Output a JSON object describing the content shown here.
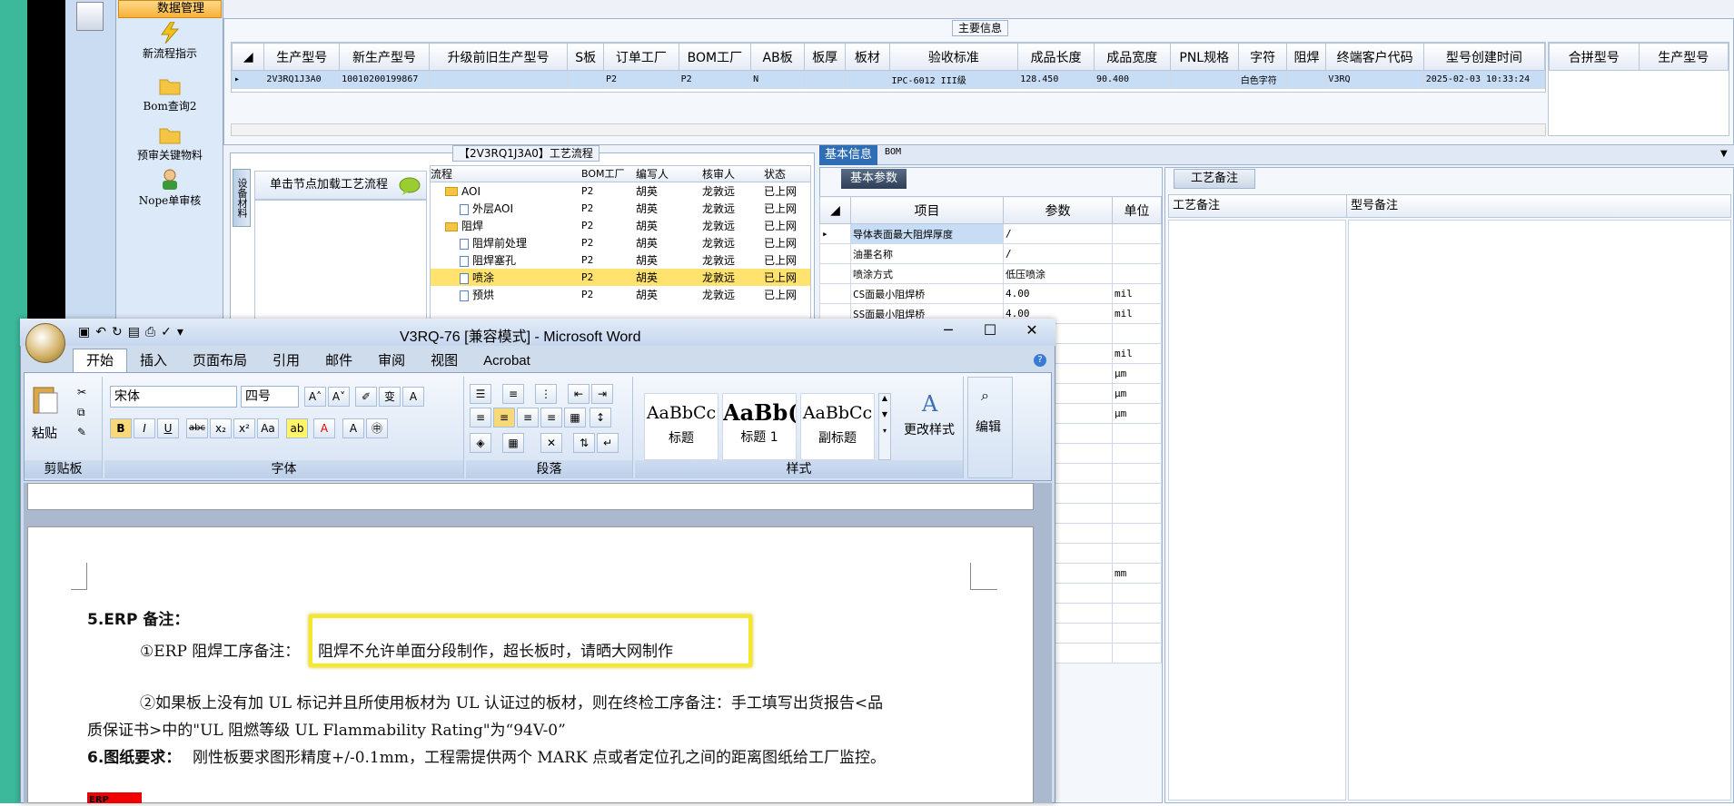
{
  "nav": {
    "data_mgmt": "数据管理",
    "items": [
      "新流程指示",
      "Bom查询2",
      "预审关键物料",
      "Nope单审核"
    ]
  },
  "main": {
    "section_title": "主要信息",
    "columns": [
      "生产型号",
      "新生产型号",
      "升级前旧生产型号",
      "S板",
      "订单工厂",
      "BOM工厂",
      "AB板",
      "板厚",
      "板材",
      "验收标准",
      "成品长度",
      "成品宽度",
      "PNL规格",
      "字符",
      "阻焊",
      "终端客户代码",
      "型号创建时间"
    ],
    "row": [
      "2V3RQ1J3A0",
      "10010200199867",
      "",
      "",
      "P2",
      "P2",
      "N",
      "",
      "",
      "IPC-6012 III级",
      "128.450",
      "90.400",
      "",
      "白色字符",
      "",
      "V3RQ",
      "2025-02-03 10:33:24"
    ],
    "merge_columns": [
      "合拼型号",
      "生产型号"
    ]
  },
  "process": {
    "title": "【2V3RQ1J3A0】工艺流程",
    "side_tab": "设备材料",
    "load_button": "单击节点加载工艺流程",
    "headers": [
      "流程",
      "BOM工厂",
      "编写人",
      "核审人",
      "状态"
    ],
    "rows": [
      {
        "name": "AOI",
        "kind": "folder",
        "indent": 1,
        "bom": "P2",
        "writer": "胡英",
        "reviewer": "龙敦远",
        "status": "已上网"
      },
      {
        "name": "外层AOI",
        "kind": "doc",
        "indent": 2,
        "bom": "P2",
        "writer": "胡英",
        "reviewer": "龙敦远",
        "status": "已上网"
      },
      {
        "name": "阻焊",
        "kind": "folder",
        "indent": 1,
        "bom": "P2",
        "writer": "胡英",
        "reviewer": "龙敦远",
        "status": "已上网"
      },
      {
        "name": "阻焊前处理",
        "kind": "doc",
        "indent": 2,
        "bom": "P2",
        "writer": "胡英",
        "reviewer": "龙敦远",
        "status": "已上网"
      },
      {
        "name": "阻焊塞孔",
        "kind": "doc",
        "indent": 2,
        "bom": "P2",
        "writer": "胡英",
        "reviewer": "龙敦远",
        "status": "已上网"
      },
      {
        "name": "喷涂",
        "kind": "doc",
        "indent": 2,
        "bom": "P2",
        "writer": "胡英",
        "reviewer": "龙敦远",
        "status": "已上网",
        "highlight": true
      },
      {
        "name": "预烘",
        "kind": "doc",
        "indent": 2,
        "bom": "P2",
        "writer": "胡英",
        "reviewer": "龙敦远",
        "status": "已上网"
      }
    ]
  },
  "basic": {
    "tab_active": "基本信息",
    "tab_bom": "BOM",
    "params_title": "基本参数",
    "headers": [
      "项目",
      "参数",
      "单位"
    ],
    "rows": [
      [
        "导体表面最大阻焊厚度",
        "/",
        ""
      ],
      [
        "油墨名称",
        "/",
        ""
      ],
      [
        "喷涂方式",
        "低压喷涂",
        ""
      ],
      [
        "CS面最小阻焊桥",
        "4.00",
        "mil"
      ],
      [
        "SS面最小阻焊桥",
        "4.00",
        "mil"
      ],
      [
        "",
        "",
        ""
      ],
      [
        "",
        "",
        "mil"
      ],
      [
        "",
        "",
        "μm"
      ],
      [
        "",
        "",
        "μm"
      ],
      [
        "",
        "",
        "μm"
      ]
    ],
    "extra_unit": "mm"
  },
  "notes": {
    "title": "工艺备注",
    "headers": [
      "工艺备注",
      "型号备注"
    ]
  },
  "word": {
    "title": "V3RQ-76 [兼容模式] - Microsoft Word",
    "tabs": [
      "开始",
      "插入",
      "页面布局",
      "引用",
      "邮件",
      "审阅",
      "视图",
      "Acrobat"
    ],
    "font_name": "宋体",
    "font_size": "四号",
    "paste_label": "粘贴",
    "groups": [
      "剪贴板",
      "字体",
      "段落",
      "样式"
    ],
    "styles": [
      {
        "sample": "AaBbCc",
        "name": "标题"
      },
      {
        "sample": "AaBb(",
        "name": "标题 1"
      },
      {
        "sample": "AaBbCc",
        "name": "副标题"
      }
    ],
    "change_styles": "更改样式",
    "edit": "编辑",
    "doc": {
      "heading5": "5.ERP 备注：",
      "line1_prefix": "①ERP 阻焊工序备注：",
      "line1_highlight": "阻焊不允许单面分段制作，超长板时，请晒大网制作",
      "line2": "②如果板上没有加 UL 标记并且所使用板材为 UL 认证过的板材，则在终检工序备注：手工填写出货报告<品",
      "line3": "质保证书>中的\"UL 阻燃等级 UL Flammability Rating\"为“94V-0”",
      "heading6": "6.图纸要求：",
      "line4": "刚性板要求图形精度+/-0.1mm，工程需提供两个 MARK 点或者定位孔之间的距离图纸给工厂监控。",
      "erp_fragment": "ERP"
    }
  }
}
